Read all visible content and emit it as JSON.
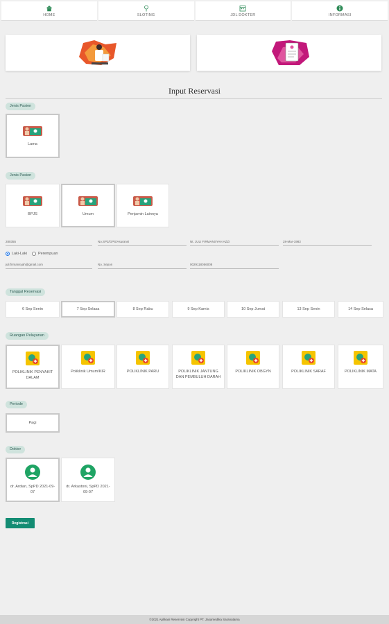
{
  "nav": [
    {
      "label": "HOME",
      "icon": "home-icon"
    },
    {
      "label": "SLOTING",
      "icon": "pin-icon"
    },
    {
      "label": "JDL DOKTER",
      "icon": "calendar-icon"
    },
    {
      "label": "INFORMASI",
      "icon": "info-icon"
    }
  ],
  "page_title": "Input Reservasi",
  "sections": {
    "jenis_pasien_1": "Jenis Pasien",
    "jenis_pasien_2": "Jenis Pasien",
    "tanggal": "Tanggal Reservasi",
    "ruangan": "Ruangan Pelayanan",
    "periode": "Periode",
    "dokter": "Dokter"
  },
  "pasien_status": [
    {
      "label": "Lama"
    }
  ],
  "penjamin": [
    {
      "label": "BPJS"
    },
    {
      "label": "Umum"
    },
    {
      "label": "Penjamin Lainnya"
    }
  ],
  "form": {
    "no_rm": "280355",
    "nik": "No.SP2/GPS/Asuransi",
    "nama": "Nt. JULI FIRMANSYAH AZZI",
    "tgl_lahir": "28-Mar-1983",
    "gender_male": "Laki-Laki",
    "gender_female": "Perempuan",
    "email": "juli.firmansyah@gmail.com",
    "telp": "No. Sepon",
    "hp": "0029118056008"
  },
  "dates": [
    {
      "label": "6 Sep Senin"
    },
    {
      "label": "7 Sep Selasa"
    },
    {
      "label": "8 Sep Rabu"
    },
    {
      "label": "9 Sep Kamis"
    },
    {
      "label": "10 Sep Jumat"
    },
    {
      "label": "13 Sep Senin"
    },
    {
      "label": "14 Sep Selasa"
    }
  ],
  "clinics": [
    {
      "label": "POLIKLINIK PENYAKIT DALAM"
    },
    {
      "label": "Poliklinik Umum/KIR"
    },
    {
      "label": "POLIKLINIK PARU"
    },
    {
      "label": "POLIKLINIK JANTUNG DAN PEMBULUH DARAH"
    },
    {
      "label": "POLIKLINIK OBGYN"
    },
    {
      "label": "POLIKLINIK SARAF"
    },
    {
      "label": "POLIKLINIK MATA"
    }
  ],
  "periode": [
    {
      "label": "Pagi"
    }
  ],
  "doctors": [
    {
      "label": "dr. Ardian, SpPD 2021-09-07"
    },
    {
      "label": "dr. Arkastoni, SpPD 2021-09-07"
    }
  ],
  "submit_label": "Registrasi",
  "footer": "©2021 Aplikasi Reservasi Copyright PT. Jasamedika Saranatama",
  "colors": {
    "accent": "#138c73",
    "pill": "#cfe3dd",
    "orange": "#e8572a",
    "magenta": "#c2187a"
  }
}
